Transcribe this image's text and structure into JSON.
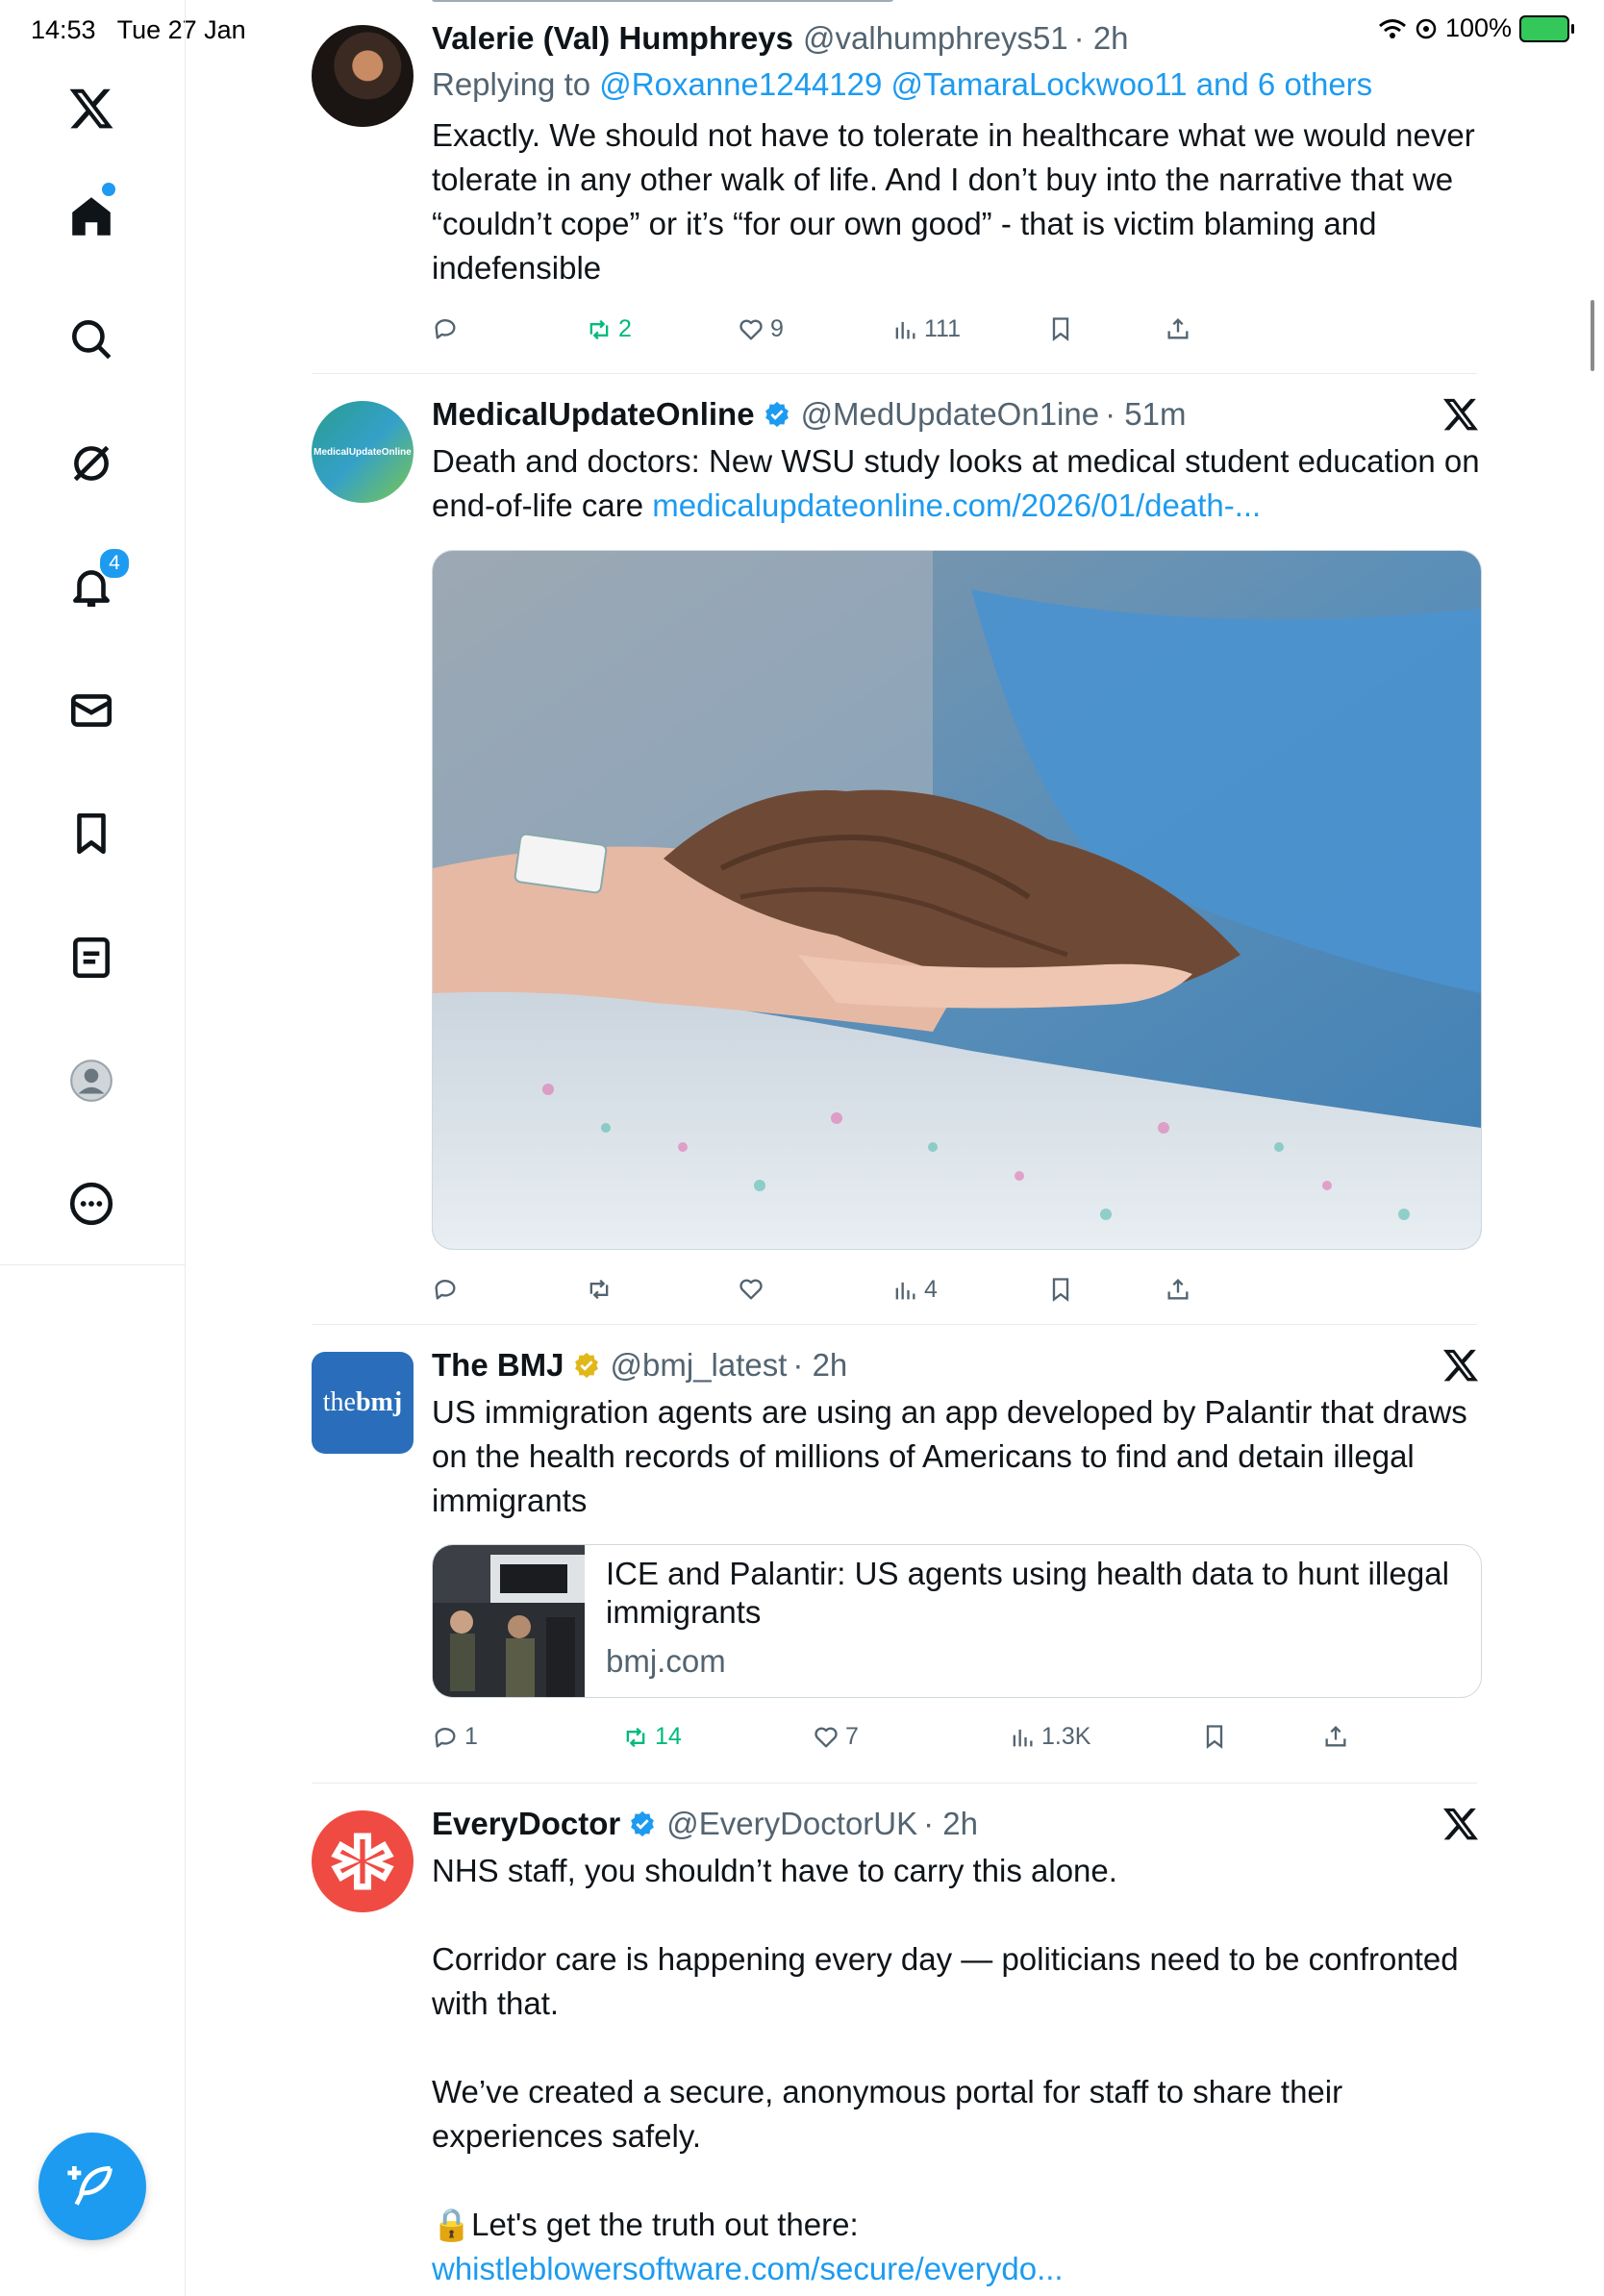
{
  "status_bar": {
    "time": "14:53",
    "date": "Tue 27 Jan",
    "battery": "100%"
  },
  "sidebar": {
    "items": [
      {
        "name": "x-logo"
      },
      {
        "name": "home"
      },
      {
        "name": "search"
      },
      {
        "name": "grok"
      },
      {
        "name": "notifications",
        "badge": "4"
      },
      {
        "name": "messages"
      },
      {
        "name": "bookmarks"
      },
      {
        "name": "lists"
      },
      {
        "name": "profile"
      },
      {
        "name": "more"
      }
    ],
    "compose": "compose-post"
  },
  "tweets": [
    {
      "name": "Valerie (Val) Humphreys",
      "handle": "@valhumphreys51",
      "time": "· 2h",
      "reply_prefix": "Replying to ",
      "reply_to": "@Roxanne1244129 @TamaraLockwoo11 and 6 others",
      "text": "Exactly. We should not have to tolerate in healthcare what we would never tolerate in any other walk of life. And I don’t buy into the narrative that we “couldn’t cope” or it’s “for our own good” - that is victim blaming and indefensible",
      "stats": {
        "replies": "",
        "reposts": "2",
        "likes": "9",
        "views": "111"
      }
    },
    {
      "name": "MedicalUpdateOnline",
      "handle": "@MedUpdateOn1ine",
      "time": "· 51m",
      "text": "Death and doctors: New WSU study looks at medical student education on end-of-life care ",
      "link": "medicalupdateonline.com/2026/01/death-...",
      "avatar_text": "MedicalUpdateOnline",
      "stats": {
        "replies": "",
        "reposts": "",
        "likes": "",
        "views": "4"
      }
    },
    {
      "name": "The BMJ",
      "handle": "@bmj_latest",
      "time": "· 2h",
      "avatar_text_1": "the",
      "avatar_text_2": "bmj",
      "text": "US immigration agents are using an app developed by Palantir that draws on the health records of millions of Americans to find and detain illegal immigrants",
      "card": {
        "title": "ICE and Palantir: US agents using health data to hunt illegal immigrants",
        "domain": "bmj.com"
      },
      "stats": {
        "replies": "1",
        "reposts": "14",
        "likes": "7",
        "views": "1.3K"
      }
    },
    {
      "name": "EveryDoctor",
      "handle": "@EveryDoctorUK",
      "time": "· 2h",
      "text_1": "NHS staff, you shouldn’t have to carry this alone.",
      "text_2": "Corridor care is happening every day — politicians need to be confronted with that.",
      "text_3": "We’ve created a secure, anonymous portal for staff to share their experiences safely.",
      "text_4": "🔒Let's get the truth out there: ",
      "link": "whistleblowersoftware.com/secure/everydo..."
    }
  ],
  "colors": {
    "accent": "#1d9bf0",
    "repost_green": "#00ba7c",
    "muted": "#536471",
    "bmj_blue": "#2a6ebb",
    "everydoctor_red": "#ef4b43",
    "gold_check": "#e2b719"
  }
}
